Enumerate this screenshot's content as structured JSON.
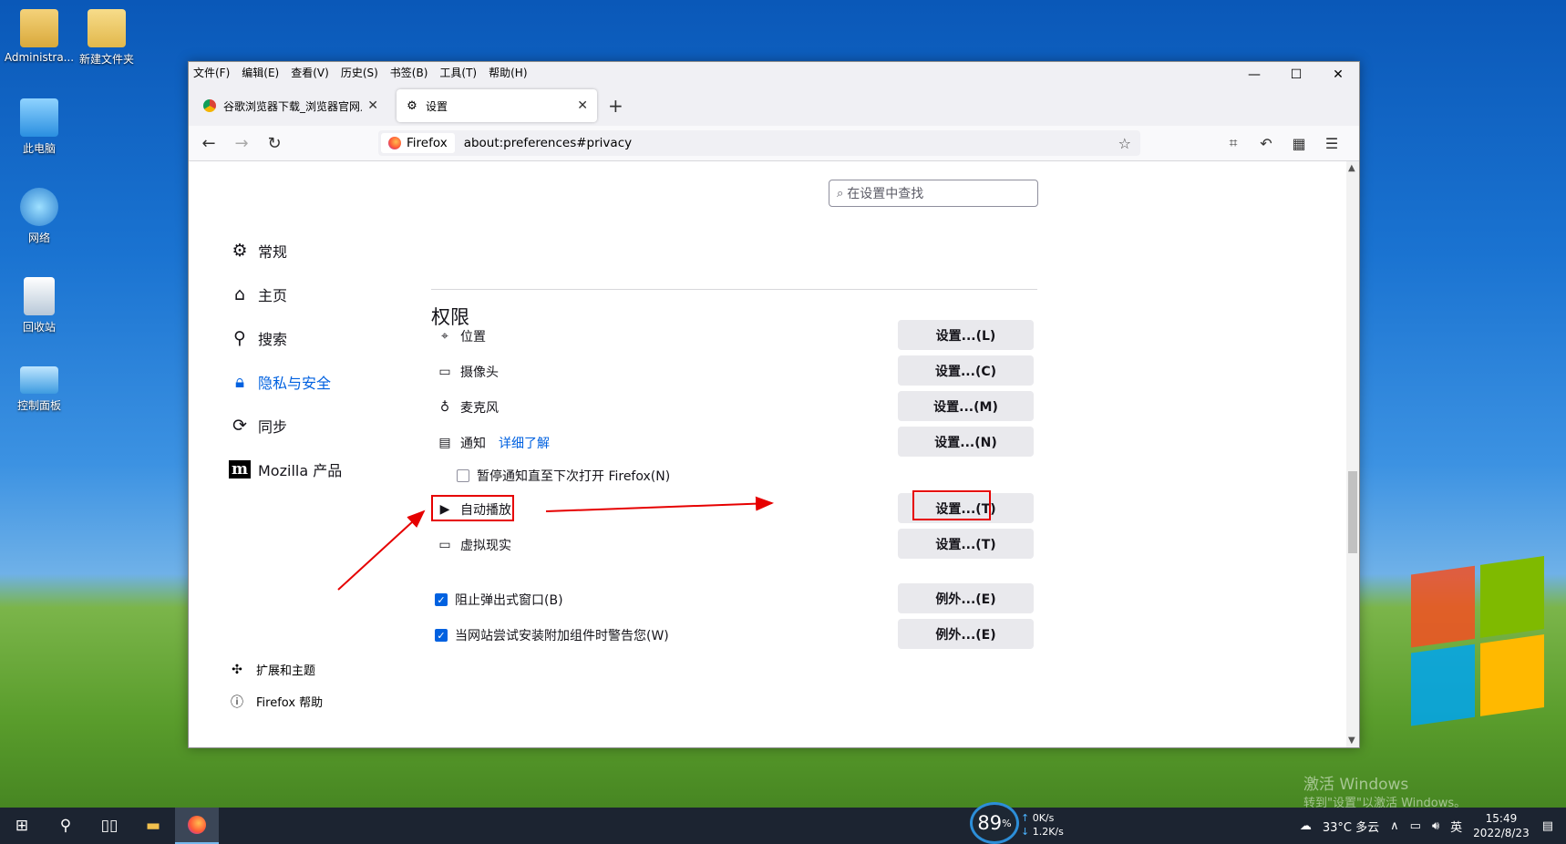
{
  "desktop": {
    "icons": [
      {
        "label": "Administra..."
      },
      {
        "label": "新建文件夹"
      },
      {
        "label": "此电脑"
      },
      {
        "label": "网络"
      },
      {
        "label": "回收站"
      },
      {
        "label": "控制面板"
      }
    ],
    "watermark": {
      "line1": "激活 Windows",
      "line2": "转到\"设置\"以激活 Windows。"
    }
  },
  "window": {
    "menu": [
      "文件(F)",
      "编辑(E)",
      "查看(V)",
      "历史(S)",
      "书签(B)",
      "工具(T)",
      "帮助(H)"
    ],
    "controls": {
      "minimize": "—",
      "maximize": "☐",
      "close": "✕"
    },
    "tabs": [
      {
        "label": "谷歌浏览器下载_浏览器官网入口",
        "close": "✕"
      },
      {
        "label": "设置",
        "close": "✕"
      }
    ],
    "new_tab": "+",
    "url": {
      "identity": "Firefox",
      "address": "about:preferences#privacy"
    }
  },
  "settings": {
    "search_placeholder": "在设置中查找",
    "nav": [
      {
        "label": "常规"
      },
      {
        "label": "主页"
      },
      {
        "label": "搜索"
      },
      {
        "label": "隐私与安全"
      },
      {
        "label": "同步"
      },
      {
        "label": "Mozilla 产品"
      }
    ],
    "bottom": [
      {
        "label": "扩展和主题"
      },
      {
        "label": "Firefox 帮助"
      }
    ],
    "section_title": "权限",
    "permissions": [
      {
        "label": "位置",
        "button": "设置...(L)"
      },
      {
        "label": "摄像头",
        "button": "设置...(C)"
      },
      {
        "label": "麦克风",
        "button": "设置...(M)"
      },
      {
        "label": "通知",
        "learn_more": "详细了解",
        "button": "设置...(N)"
      },
      {
        "label": "自动播放",
        "button": "设置...(T)"
      },
      {
        "label": "虚拟现实",
        "button": "设置...(T)"
      }
    ],
    "pause_notifications": "暂停通知直至下次打开 Firefox(N)",
    "block_popups": {
      "label": "阻止弹出式窗口(B)",
      "checked": true,
      "button": "例外...(E)"
    },
    "warn_addons": {
      "label": "当网站尝试安装附加组件时警告您(W)",
      "checked": true,
      "button": "例外...(E)"
    },
    "pause_checked": false
  },
  "taskbar": {
    "meter_percent": "89",
    "meter_unit": "%",
    "upload": "0K/s",
    "download": "1.2K/s",
    "weather": "33°C 多云",
    "ime": "英",
    "time": "15:49",
    "date": "2022/8/23"
  },
  "colors": {
    "accent": "#0061e0",
    "annotation": "#e60000"
  }
}
